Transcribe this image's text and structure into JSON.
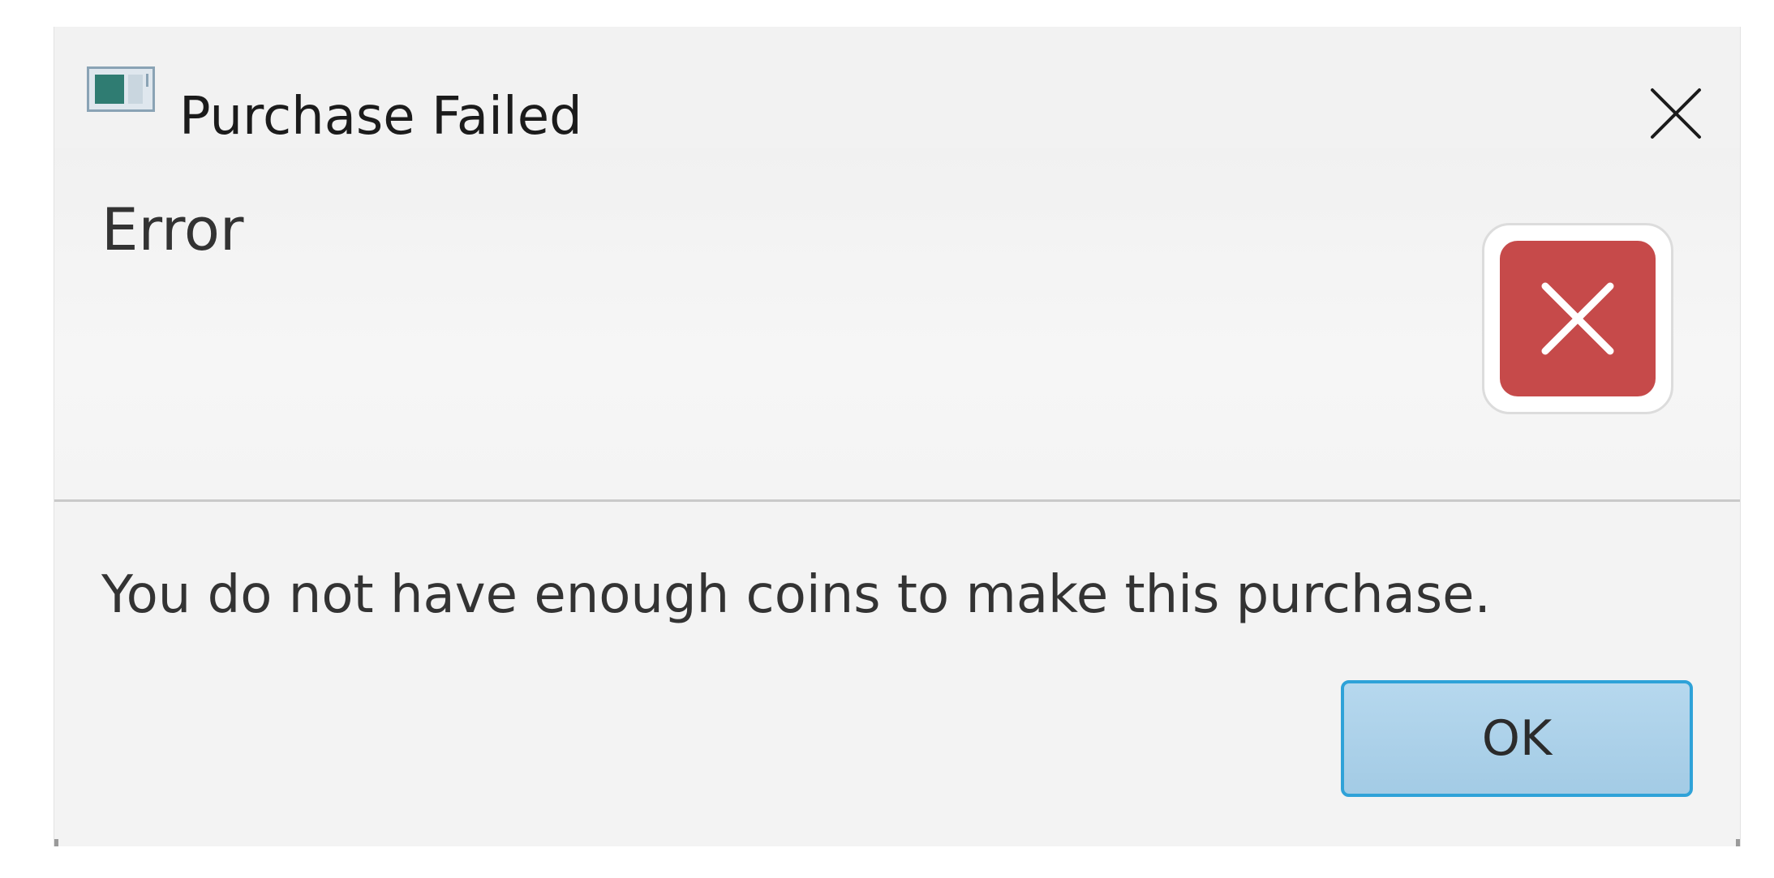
{
  "window": {
    "title": "Purchase Failed"
  },
  "dialog": {
    "header": "Error",
    "message": "You do not have enough coins to make this purchase.",
    "ok_label": "OK"
  },
  "icons": {
    "app": "app-window-icon",
    "close": "close-icon",
    "error": "error-icon"
  },
  "colors": {
    "error_red": "#c64a4a",
    "button_border": "#2fa2d8",
    "button_fill": "#b6d8ee"
  }
}
